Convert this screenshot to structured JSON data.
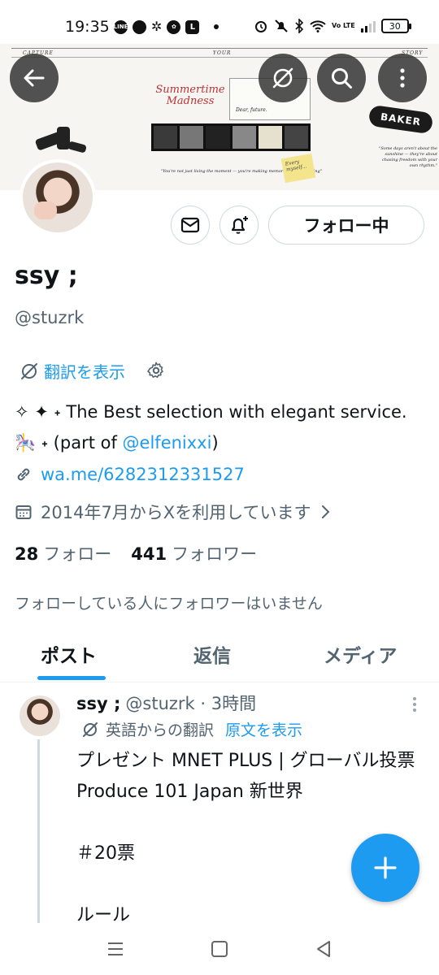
{
  "status_bar": {
    "time": "19:35",
    "battery": "30",
    "network_label": "Vo LTE",
    "left_icons": [
      "line-icon",
      "chat-icon",
      "pinwheel-icon",
      "flower-icon",
      "l-app-icon",
      "dot-icon"
    ],
    "right_icons": [
      "alarm-icon",
      "mute-icon",
      "bluetooth-icon",
      "wifi-icon",
      "signal-icon",
      "battery-icon"
    ]
  },
  "banner": {
    "label_left": "CAPTURE",
    "label_mid": "YOUR",
    "label_right": "STORY",
    "title": "Summertime Madness",
    "card_text": "Dear, future.",
    "caption_left": "\"You're not just living the moment — you're making memories worth keeping\"",
    "sticky_text": "Every myself...",
    "skate_text": "BAKER",
    "caption_right": "\"Some days aren't about the sunshine — they're about chasing freedom with your own rhythm.\""
  },
  "profile": {
    "display_name": "ssy ;",
    "handle": "@stuzrk",
    "follow_button": "フォロー中",
    "translate_label": "翻訳を表示",
    "bio_line1": "✧ ✦ ˖ The Best selection with elegant service.",
    "bio_line2_emoji": "🎠 ˖ (part of ",
    "bio_mention": "@elfenixxi",
    "bio_line2_end": ")",
    "link": "wa.me/6282312331527",
    "joined": "2014年7月からXを利用しています",
    "following_count": "28",
    "following_label": "フォロー",
    "followers_count": "441",
    "followers_label": "フォロワー",
    "no_mutual_followers": "フォローしている人にフォロワーはいません"
  },
  "tabs": [
    "ポスト",
    "返信",
    "メディア"
  ],
  "post": {
    "name": "ssy ;",
    "meta": "@stuzrk · 3時間",
    "translated_from": "英語からの翻訳",
    "show_original": "原文を表示",
    "body": "プレゼント MNET PLUS | グローバル投票 Produce 101 Japan 新世界\n\n＃20票\n\nルール"
  },
  "colors": {
    "accent": "#1d9bf0",
    "text_primary": "#0f1419",
    "text_secondary": "#536471",
    "border": "#cfd9de"
  }
}
